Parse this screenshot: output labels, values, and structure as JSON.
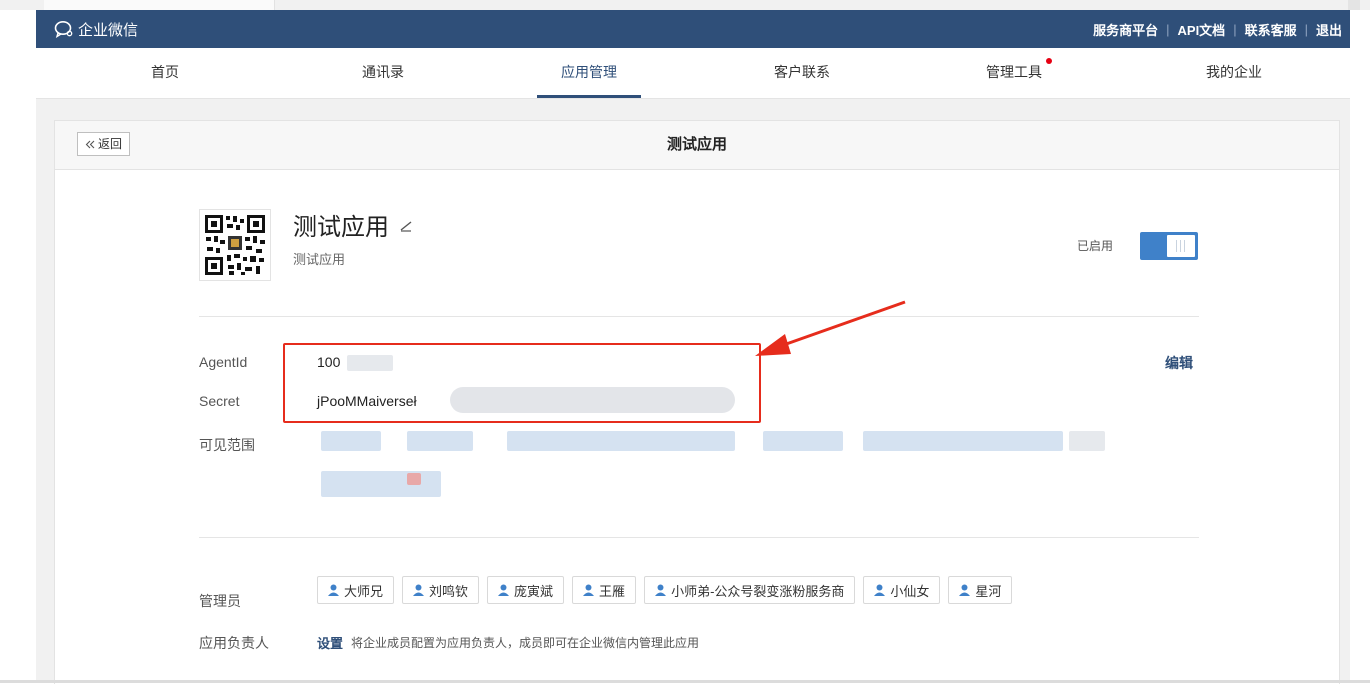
{
  "topbar": {
    "brand": "企业微信",
    "links": [
      "服务商平台",
      "API文档",
      "联系客服",
      "退出"
    ]
  },
  "nav": {
    "items": [
      "首页",
      "通讯录",
      "应用管理",
      "客户联系",
      "管理工具",
      "我的企业"
    ],
    "active": "应用管理"
  },
  "page": {
    "back_label": "返回",
    "title": "测试应用"
  },
  "app": {
    "name": "测试应用",
    "description": "测试应用",
    "status_label": "已启用",
    "enabled": true
  },
  "credentials": {
    "agentid_label": "AgentId",
    "agentid_value": "100",
    "secret_label": "Secret",
    "secret_value": "jPooMMaiverseł",
    "edit_label": "编辑"
  },
  "visibility": {
    "label": "可见范围"
  },
  "admins": {
    "label": "管理员",
    "list": [
      "大师兄",
      "刘鸣钦",
      "庞寅斌",
      "王雁",
      "小师弟-公众号裂变涨粉服务商",
      "小仙女",
      "星河"
    ]
  },
  "owner": {
    "label": "应用负责人",
    "action": "设置",
    "tip": "将企业成员配置为应用负责人，成员即可在企业微信内管理此应用"
  },
  "colors": {
    "topbar": "#2f4f79",
    "accent": "#3f81c9",
    "highlight_box": "#e62c1c",
    "notification_dot": "#e60012"
  }
}
